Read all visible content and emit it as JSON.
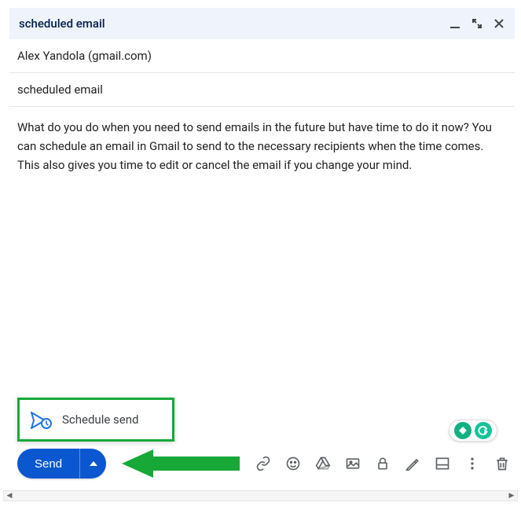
{
  "header": {
    "title": "scheduled email"
  },
  "fields": {
    "to": "Alex Yandola (gmail.com)",
    "subject": "scheduled email"
  },
  "body": "What do you do when you need to send emails in the future but have time to do it now? You can schedule an email in Gmail to send to the necessary recipients when the time comes. This also gives you time to edit or cancel the email if you change your mind.",
  "schedule": {
    "label": "Schedule send"
  },
  "send": {
    "label": "Send"
  },
  "colors": {
    "primary": "#0b57d0",
    "highlight": "#17a838",
    "grammarly": "#15c39a"
  }
}
